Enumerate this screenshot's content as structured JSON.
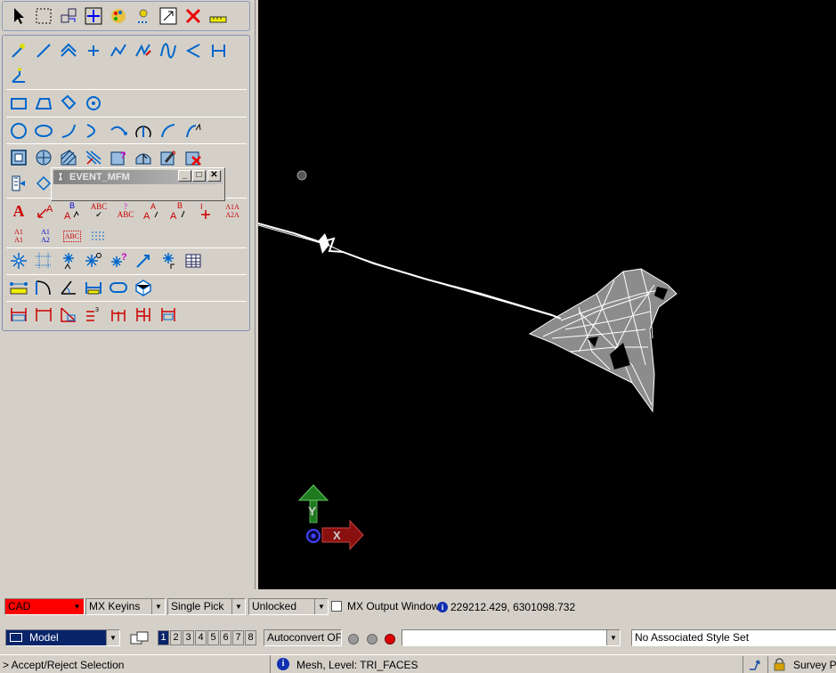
{
  "event_window": {
    "title": "EVENT_MFM"
  },
  "text_icons": {
    "place_text": "A",
    "abc": "ABC",
    "a1a2": "A1A",
    "a2a": "A2A",
    "a1_left": "A1",
    "a1_sub": "A1",
    "a1_right": "A1",
    "a2_sub": "A2",
    "abc_box": "ABC"
  },
  "view": {
    "axis_y_label": "Y",
    "axis_x_label": "X"
  },
  "status_bar_1": {
    "mode_select": "CAD",
    "keyins_select": "MX Keyins",
    "pick_select": "Single Pick",
    "lock_select": "Unlocked",
    "mx_output_label": "MX Output Window",
    "coordinates": "229212.429, 6301098.732"
  },
  "status_bar_2": {
    "model_select": "Model",
    "view_numbers": [
      "1",
      "2",
      "3",
      "4",
      "5",
      "6",
      "7",
      "8"
    ],
    "autoconvert_label": "Autoconvert OFF",
    "command_input": "",
    "style_set": "No Associated Style Set"
  },
  "status_bar_3": {
    "prompt": "> Accept/Reject Selection",
    "element_info": "Mesh, Level: TRI_FACES",
    "survey_label": "Survey Po"
  },
  "colors": {
    "mode_select_bg": "#ff0000",
    "view_bg": "#000000",
    "mesh": "#ffffff",
    "y_axis": "#1e7a1e",
    "x_axis": "#8a1010"
  }
}
